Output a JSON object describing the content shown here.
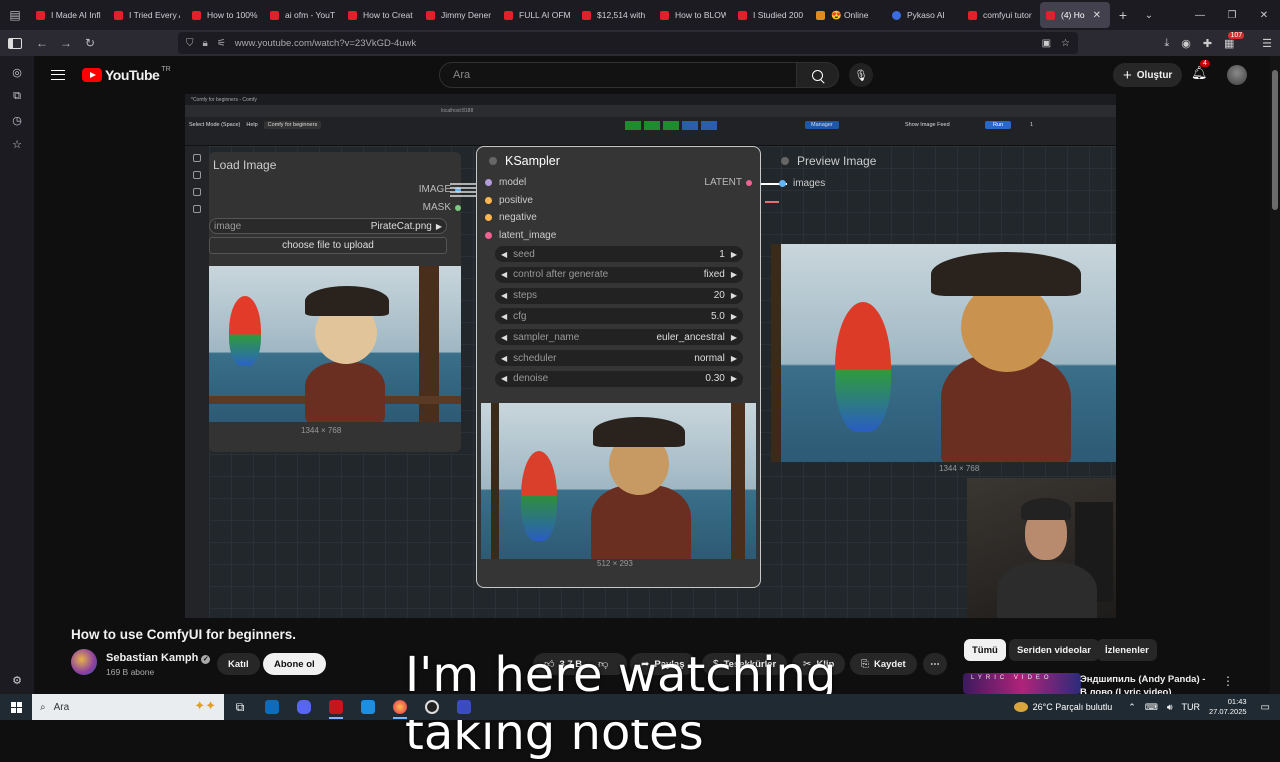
{
  "browser": {
    "tabs": [
      {
        "label": "I Made AI Infl",
        "favicon": "youtube-favicon"
      },
      {
        "label": "I Tried Every A",
        "favicon": "youtube-favicon"
      },
      {
        "label": "How to 100%",
        "favicon": "youtube-favicon"
      },
      {
        "label": "ai ofm - YouT",
        "favicon": "youtube-favicon"
      },
      {
        "label": "How to Creat",
        "favicon": "youtube-favicon"
      },
      {
        "label": "Jimmy Dener",
        "favicon": "youtube-favicon"
      },
      {
        "label": "FULL AI OFM",
        "favicon": "youtube-favicon"
      },
      {
        "label": "$12,514 with",
        "favicon": "youtube-favicon"
      },
      {
        "label": "How to BLOW",
        "favicon": "youtube-favicon"
      },
      {
        "label": "I Studied 200",
        "favicon": "youtube-favicon"
      },
      {
        "label": "😍 Online",
        "favicon": "site-favicon"
      },
      {
        "label": "Pykaso AI",
        "favicon": "pykaso-favicon"
      },
      {
        "label": "comfyui tutor",
        "favicon": "youtube-favicon"
      },
      {
        "label": "(4) Ho",
        "favicon": "youtube-favicon",
        "active": true
      }
    ],
    "url": "www.youtube.com/watch?v=23VkGD-4uwk",
    "extensions_badge": "107"
  },
  "youtube": {
    "logo_text": "YouTube",
    "country_code": "TR",
    "search_placeholder": "Ara",
    "create_label": "Oluştur",
    "notifications_count": "4"
  },
  "video": {
    "title": "How to use ComfyUI for beginners.",
    "caption_line1": "I'm here watching",
    "caption_line2": "taking notes",
    "channel_name": "Sebastian Kamph",
    "subscribers": "169 B abone",
    "join_label": "Katıl",
    "subscribe_label": "Abone ol",
    "likes": "3,7 B",
    "share_label": "Paylaş",
    "thanks_label": "Teşekkürler",
    "clip_label": "Klip",
    "save_label": "Kaydet"
  },
  "comfy": {
    "browser_tab": "*Comfy for beginners - Comfy",
    "address": "localhost:8188",
    "menu_select": "Select Mode (Space)",
    "menu_help": "Help",
    "workflow_tab": "Comfy for beginners",
    "manager_label": "Manager",
    "show_image_feed": "Show Image Feed",
    "run_label": "Run",
    "run_count": "1",
    "load_image": {
      "title": "Load Image",
      "out_image": "IMAGE",
      "out_mask": "MASK",
      "image_label": "image",
      "image_value": "PirateCat.png",
      "upload_label": "choose file to upload",
      "size": "1344 × 768"
    },
    "ksampler": {
      "title": "KSampler",
      "inputs": [
        "model",
        "positive",
        "negative",
        "latent_image"
      ],
      "output": "LATENT",
      "widgets": [
        {
          "label": "seed",
          "value": "1"
        },
        {
          "label": "control after generate",
          "value": "fixed"
        },
        {
          "label": "steps",
          "value": "20"
        },
        {
          "label": "cfg",
          "value": "5.0"
        },
        {
          "label": "sampler_name",
          "value": "euler_ancestral"
        },
        {
          "label": "scheduler",
          "value": "normal"
        },
        {
          "label": "denoise",
          "value": "0.30"
        }
      ],
      "size": "512 × 293"
    },
    "preview": {
      "title": "Preview Image",
      "input": "images",
      "size": "1344 × 768"
    }
  },
  "related": {
    "chips": [
      "Tümü",
      "Seriden videolar",
      "İzlenenler"
    ],
    "first_title": "Эндшипиль (Andy Panda) - B лово (Lyric video)",
    "thumb_text": "LYRIC VIDEO"
  },
  "taskbar": {
    "search_placeholder": "Ara",
    "weather": "26°C  Parçalı bulutlu",
    "language": "TUR",
    "time": "01:43",
    "date": "27.07.2025"
  }
}
